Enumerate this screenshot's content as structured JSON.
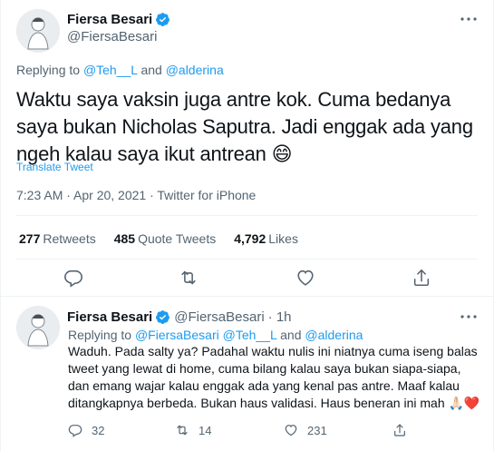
{
  "main_tweet": {
    "author_name": "Fiersa Besari",
    "author_handle": "@FiersaBesari",
    "replying_prefix": "Replying to ",
    "replying_user1": "@Teh__L",
    "replying_and": " and ",
    "replying_user2": "@alderina",
    "text": "Waktu saya vaksin juga antre kok. Cuma bedanya saya bukan Nicholas Saputra. Jadi enggak ada yang ngeh kalau saya ikut antrean",
    "emoji": "😄",
    "translate_label": "Translate Tweet",
    "timestamp": "7:23 AM · Apr 20, 2021 · Twitter for iPhone",
    "retweets_count": "277",
    "retweets_label": "Retweets",
    "quotes_count": "485",
    "quotes_label": "Quote Tweets",
    "likes_count": "4,792",
    "likes_label": "Likes"
  },
  "reply_tweet": {
    "author_name": "Fiersa Besari",
    "author_handle": "@FiersaBesari",
    "time": "· 1h",
    "replying_prefix": "Replying to ",
    "replying_users": "@FiersaBesari @Teh__L",
    "replying_and": " and ",
    "replying_user3": "@alderina",
    "text": "Waduh. Pada salty ya? Padahal waktu nulis ini niatnya cuma iseng balas tweet yang lewat di home, cuma bilang kalau saya bukan siapa-siapa, dan emang wajar kalau enggak ada yang kenal pas antre. Maaf kalau ditangkapnya berbeda. Bukan haus validasi. Haus beneran ini mah 🙏🏻❤️",
    "reply_count": "32",
    "retweet_count": "14",
    "like_count": "231"
  },
  "colors": {
    "accent": "#1d9bf0",
    "text": "#0f1419",
    "muted": "#536471",
    "divider": "#eff3f4"
  },
  "icons": [
    "verified-badge-icon",
    "more-icon",
    "reply-icon",
    "retweet-icon",
    "like-icon",
    "share-icon"
  ]
}
